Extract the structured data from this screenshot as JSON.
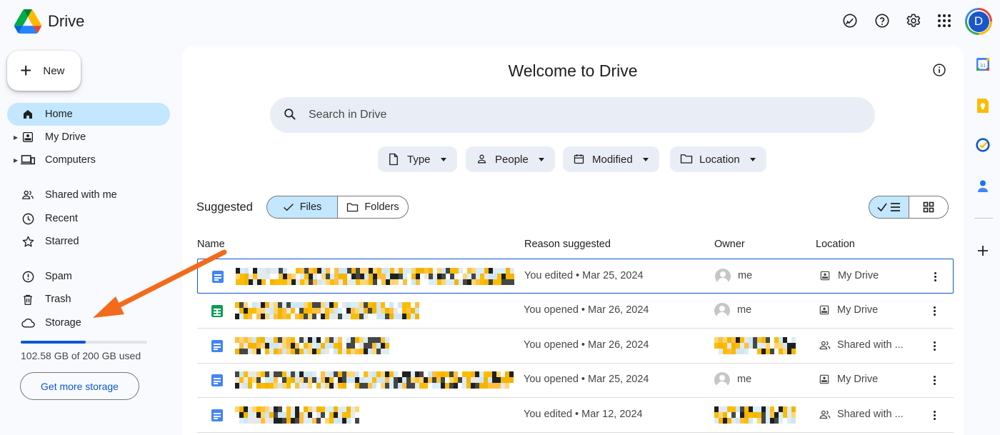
{
  "app": {
    "title": "Drive"
  },
  "header": {
    "icons": [
      "ready-for-offline-icon",
      "help-icon",
      "settings-icon",
      "apps-grid-icon"
    ],
    "avatar_letter": "D"
  },
  "sidebar": {
    "new_label": "New",
    "items": [
      {
        "label": "Home",
        "icon": "home-icon",
        "active": true
      },
      {
        "label": "My Drive",
        "icon": "my-drive-icon",
        "expandable": true
      },
      {
        "label": "Computers",
        "icon": "computers-icon",
        "expandable": true
      },
      {
        "label": "Shared with me",
        "icon": "shared-icon"
      },
      {
        "label": "Recent",
        "icon": "recent-icon"
      },
      {
        "label": "Starred",
        "icon": "starred-icon"
      },
      {
        "label": "Spam",
        "icon": "spam-icon"
      },
      {
        "label": "Trash",
        "icon": "trash-icon"
      },
      {
        "label": "Storage",
        "icon": "cloud-icon"
      }
    ],
    "storage": {
      "used_text": "102.58 GB of 200 GB used",
      "used_fraction": 0.5129,
      "cta": "Get more storage"
    }
  },
  "main": {
    "welcome": "Welcome to Drive",
    "search_placeholder": "Search in Drive",
    "filters": [
      "Type",
      "People",
      "Modified",
      "Location"
    ],
    "suggested_label": "Suggested",
    "toggle": {
      "files": "Files",
      "folders": "Folders",
      "selected": "Files"
    },
    "view": {
      "selected": "list"
    },
    "columns": {
      "name": "Name",
      "reason": "Reason suggested",
      "owner": "Owner",
      "location": "Location"
    },
    "rows": [
      {
        "type": "doc",
        "reason": "You edited • Mar 25, 2024",
        "owner": "me",
        "location": "My Drive",
        "location_icon": "my-drive-icon"
      },
      {
        "type": "sheet",
        "reason": "You opened • Mar 26, 2024",
        "owner": "me",
        "location": "My Drive",
        "location_icon": "my-drive-icon"
      },
      {
        "type": "doc",
        "reason": "You opened • Mar 26, 2024",
        "owner": "",
        "location": "Shared with ...",
        "location_icon": "shared-icon"
      },
      {
        "type": "doc",
        "reason": "You opened • Mar 25, 2024",
        "owner": "me",
        "location": "My Drive",
        "location_icon": "my-drive-icon"
      },
      {
        "type": "doc",
        "reason": "You edited • Mar 12, 2024",
        "owner": "",
        "location": "Shared with ...",
        "location_icon": "shared-icon"
      }
    ]
  },
  "right_rail": [
    "calendar-icon",
    "keep-icon",
    "tasks-icon",
    "contacts-icon",
    "add-apps-icon"
  ],
  "colors": {
    "accent": "#0b57d0",
    "active_nav": "#c2e7ff",
    "annotation_arrow": "#f26b1d"
  }
}
